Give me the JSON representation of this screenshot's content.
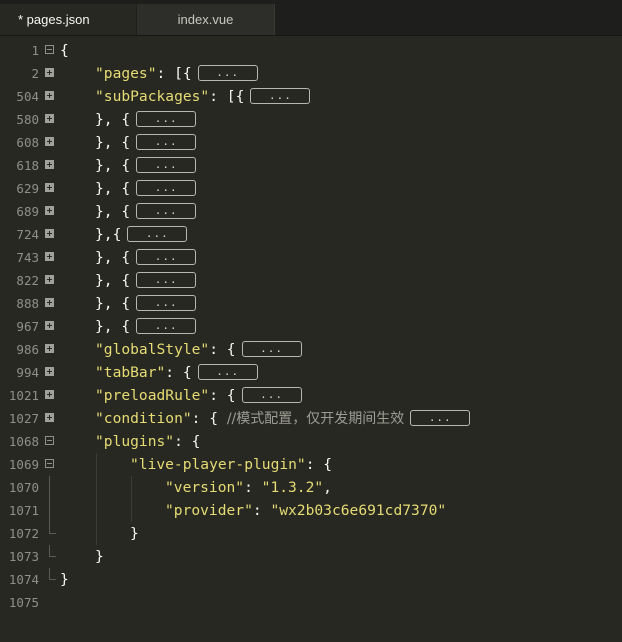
{
  "tabs": [
    {
      "label": "* pages.json",
      "active": true
    },
    {
      "label": "index.vue",
      "active": false
    }
  ],
  "collapsed_placeholder": "...",
  "lines": [
    {
      "n": "1",
      "fold": "minus",
      "indent": 0,
      "parts": [
        {
          "t": "{",
          "c": "p"
        }
      ]
    },
    {
      "n": "2",
      "fold": "plus",
      "indent": 1,
      "parts": [
        {
          "t": "\"pages\"",
          "c": "k"
        },
        {
          "t": ": [{",
          "c": "p"
        }
      ],
      "collapsed": true
    },
    {
      "n": "504",
      "fold": "plus",
      "indent": 1,
      "parts": [
        {
          "t": "\"subPackages\"",
          "c": "k"
        },
        {
          "t": ": [{",
          "c": "p"
        }
      ],
      "collapsed": true
    },
    {
      "n": "580",
      "fold": "plus",
      "indent": 1,
      "parts": [
        {
          "t": "}, {",
          "c": "p"
        }
      ],
      "collapsed": true
    },
    {
      "n": "608",
      "fold": "plus",
      "indent": 1,
      "parts": [
        {
          "t": "}, {",
          "c": "p"
        }
      ],
      "collapsed": true
    },
    {
      "n": "618",
      "fold": "plus",
      "indent": 1,
      "parts": [
        {
          "t": "}, {",
          "c": "p"
        }
      ],
      "collapsed": true
    },
    {
      "n": "629",
      "fold": "plus",
      "indent": 1,
      "parts": [
        {
          "t": "}, {",
          "c": "p"
        }
      ],
      "collapsed": true
    },
    {
      "n": "689",
      "fold": "plus",
      "indent": 1,
      "parts": [
        {
          "t": "}, {",
          "c": "p"
        }
      ],
      "collapsed": true
    },
    {
      "n": "724",
      "fold": "plus",
      "indent": 1,
      "parts": [
        {
          "t": "},{",
          "c": "p"
        }
      ],
      "collapsed": true
    },
    {
      "n": "743",
      "fold": "plus",
      "indent": 1,
      "parts": [
        {
          "t": "}, {",
          "c": "p"
        }
      ],
      "collapsed": true
    },
    {
      "n": "822",
      "fold": "plus",
      "indent": 1,
      "parts": [
        {
          "t": "}, {",
          "c": "p"
        }
      ],
      "collapsed": true
    },
    {
      "n": "888",
      "fold": "plus",
      "indent": 1,
      "parts": [
        {
          "t": "}, {",
          "c": "p"
        }
      ],
      "collapsed": true
    },
    {
      "n": "967",
      "fold": "plus",
      "indent": 1,
      "parts": [
        {
          "t": "}, {",
          "c": "p"
        }
      ],
      "collapsed": true
    },
    {
      "n": "986",
      "fold": "plus",
      "indent": 1,
      "parts": [
        {
          "t": "\"globalStyle\"",
          "c": "k"
        },
        {
          "t": ": {",
          "c": "p"
        }
      ],
      "collapsed": true
    },
    {
      "n": "994",
      "fold": "plus",
      "indent": 1,
      "parts": [
        {
          "t": "\"tabBar\"",
          "c": "k"
        },
        {
          "t": ": {",
          "c": "p"
        }
      ],
      "collapsed": true
    },
    {
      "n": "1021",
      "fold": "plus",
      "indent": 1,
      "parts": [
        {
          "t": "\"preloadRule\"",
          "c": "k"
        },
        {
          "t": ": {",
          "c": "p"
        }
      ],
      "collapsed": true
    },
    {
      "n": "1027",
      "fold": "plus",
      "indent": 1,
      "parts": [
        {
          "t": "\"condition\"",
          "c": "k"
        },
        {
          "t": ": { ",
          "c": "p"
        },
        {
          "t": "//模式配置，仅开发期间生效",
          "c": "c"
        }
      ],
      "collapsed": true
    },
    {
      "n": "1068",
      "fold": "minus",
      "indent": 1,
      "parts": [
        {
          "t": "\"plugins\"",
          "c": "k"
        },
        {
          "t": ": {",
          "c": "p"
        }
      ]
    },
    {
      "n": "1069",
      "fold": "minus",
      "indent": 2,
      "parts": [
        {
          "t": "\"live-player-plugin\"",
          "c": "k"
        },
        {
          "t": ": {",
          "c": "p"
        }
      ]
    },
    {
      "n": "1070",
      "fold": "line",
      "indent": 3,
      "parts": [
        {
          "t": "\"version\"",
          "c": "k"
        },
        {
          "t": ": ",
          "c": "p"
        },
        {
          "t": "\"1.3.2\"",
          "c": "k"
        },
        {
          "t": ",",
          "c": "p"
        }
      ]
    },
    {
      "n": "1071",
      "fold": "line",
      "indent": 3,
      "parts": [
        {
          "t": "\"provider\"",
          "c": "k"
        },
        {
          "t": ": ",
          "c": "p"
        },
        {
          "t": "\"wx2b03c6e691cd7370\"",
          "c": "k"
        }
      ]
    },
    {
      "n": "1072",
      "fold": "end",
      "indent": 2,
      "parts": [
        {
          "t": "}",
          "c": "p"
        }
      ]
    },
    {
      "n": "1073",
      "fold": "end",
      "indent": 1,
      "parts": [
        {
          "t": "}",
          "c": "p"
        }
      ]
    },
    {
      "n": "1074",
      "fold": "end",
      "indent": 0,
      "parts": [
        {
          "t": "}",
          "c": "p"
        }
      ]
    },
    {
      "n": "1075",
      "fold": "none",
      "indent": 0,
      "parts": []
    }
  ]
}
